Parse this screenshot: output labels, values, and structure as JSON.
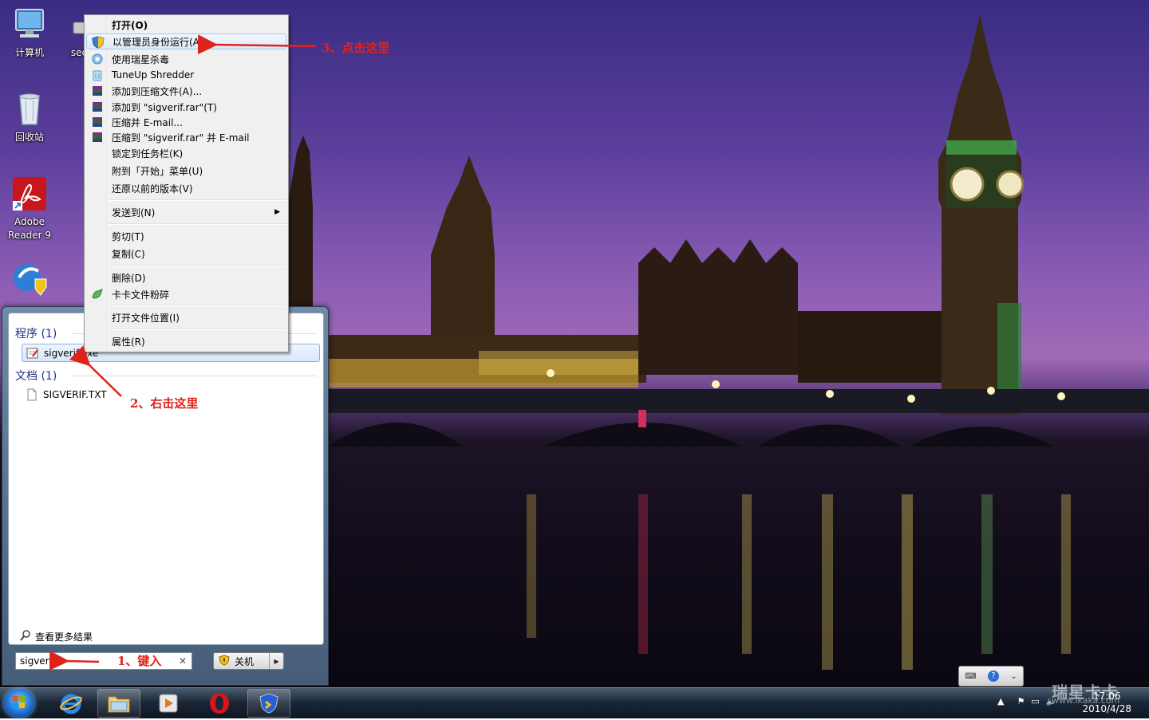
{
  "desktop": {
    "icons": [
      {
        "label": "计算机"
      },
      {
        "label": "secte"
      },
      {
        "label": "回收站"
      },
      {
        "label": "Adobe Reader 9"
      }
    ]
  },
  "context_menu": {
    "items": [
      {
        "label": "打开(O)"
      },
      {
        "label": "以管理员身份运行(A)"
      },
      {
        "label": "使用瑞星杀毒"
      },
      {
        "label": "TuneUp Shredder"
      },
      {
        "label": "添加到压缩文件(A)..."
      },
      {
        "label": "添加到 \"sigverif.rar\"(T)"
      },
      {
        "label": "压缩并 E-mail..."
      },
      {
        "label": "压缩到 \"sigverif.rar\" 并 E-mail"
      },
      {
        "label": "锁定到任务栏(K)"
      },
      {
        "label": "附到「开始」菜单(U)"
      },
      {
        "label": "还原以前的版本(V)"
      },
      {
        "label": "发送到(N)"
      },
      {
        "label": "剪切(T)"
      },
      {
        "label": "复制(C)"
      },
      {
        "label": "删除(D)"
      },
      {
        "label": "卡卡文件粉碎"
      },
      {
        "label": "打开文件位置(I)"
      },
      {
        "label": "属性(R)"
      }
    ]
  },
  "start_menu": {
    "programs_header": "程序 (1)",
    "program_item": "sigverif.exe",
    "documents_header": "文档 (1)",
    "document_item": "SIGVERIF.TXT",
    "see_more": "查看更多结果",
    "search_value": "sigverif",
    "shutdown_label": "关机"
  },
  "annotations": {
    "step1": "1、键入",
    "step2": "2、右击这里",
    "step3": "3、点击这里",
    "color": "#e0231a"
  },
  "taskbar": {
    "time": "17:06",
    "date": "2010/4/28"
  },
  "watermark": {
    "brand": "瑞星卡卡",
    "url": "www.ikaka.com"
  }
}
